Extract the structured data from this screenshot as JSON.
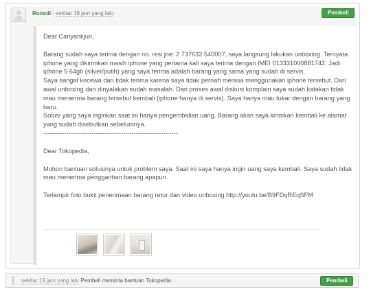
{
  "comment": {
    "author": "Roosdi",
    "separator": "-",
    "timestamp": "sekitar 19 jam yang lalu",
    "role_badge": "Pembeli",
    "lines": {
      "greeting_seller": "Dear Canyankjun,",
      "p1": "Barang sudah saya terima dengan no. resi jne: 2 737632 540007, saya langsung lakukan unboxing. Ternyata iphone yang dikirimkan masih iphone yang pertama kali saya terima dengan IMEI 013331000881742. Jadi iphone 5 64gb (silver/putih) yang saya terima adalah barang yang sama yang sudah di servis.",
      "p2": "Saya sangat kecewa dan tidak terima karena saya tidak pernah merasa menggunakan iphone tersebut. Dari awal unboxing dan dinyalakan sudah masalah. Dari proses awal diskusi komplain saya sudah katakan tidak mau menerima barang tersebut kembali (iphone hanya di servis). Saya hanya mau tukar dengan barang yang baru.",
      "p3": "Solusi yang saya inginkan saat ini hanya pengembalian uang. Barang akan saya kirimkan kembali ke alamat yang sudah disebutkan sebelumnya.",
      "divider": "----------------------------------------------------------------",
      "greeting_admin": "Dear Tokopedia,",
      "p4": "Mohon bantuan solusinya untuk problem saya. Saat ini saya hanya ingin uang saya kembali. Saya sudah tidak mau menerima penggantian barang apapun.",
      "p5": "Terlampir foto bukti penerimaan barang retur dan video unboxing http://youtu.be/B9FDqREqSFM"
    },
    "attachments": [
      "photo-1",
      "photo-2",
      "photo-3"
    ]
  },
  "activity": {
    "timestamp": "sekitar 19 jam yang lalu",
    "text": "Pembeli meminta bantuan Tokopedia.",
    "role_badge": "Pembeli"
  },
  "colors": {
    "badge_green": "#42a047",
    "author_green": "#2e8b2e"
  }
}
